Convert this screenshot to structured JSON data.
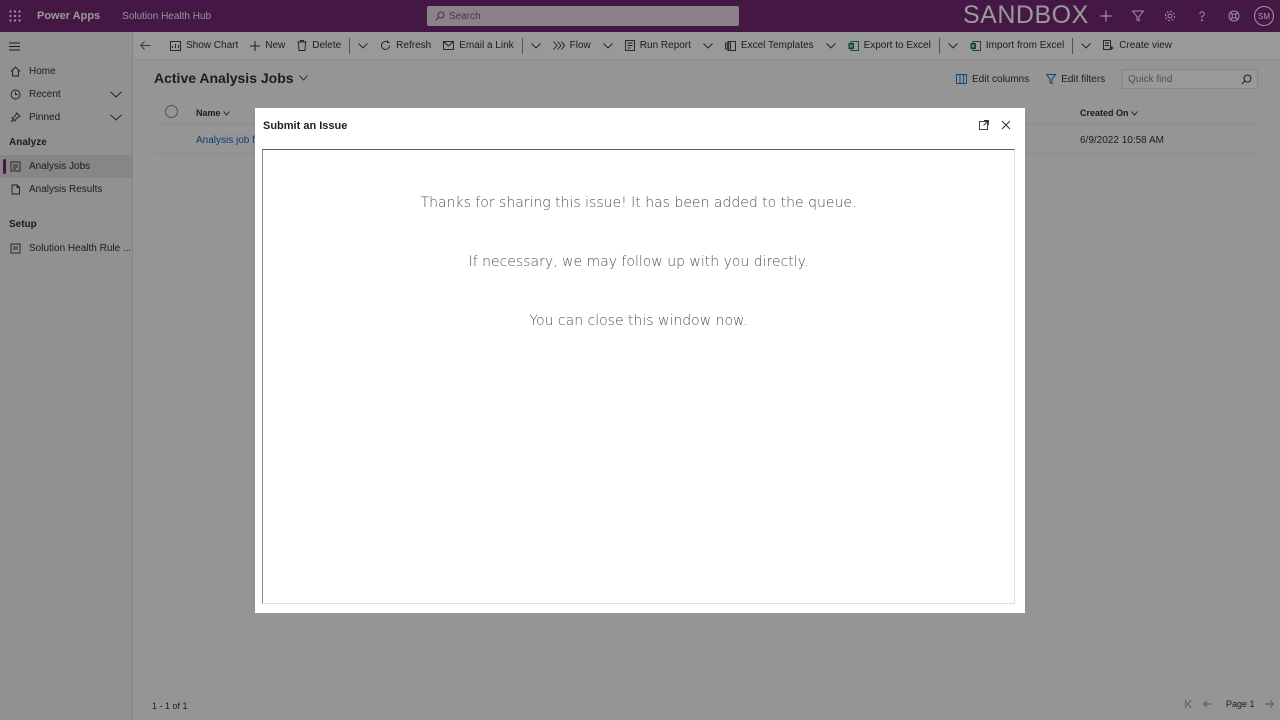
{
  "topbar": {
    "app_name": "Power Apps",
    "environment_title": "Solution Health Hub",
    "search_placeholder": "Search",
    "banner": "SANDBOX",
    "avatar_initials": "SM",
    "accent_color": "#742774"
  },
  "nav": {
    "items": [
      {
        "label": "Home"
      },
      {
        "label": "Recent"
      },
      {
        "label": "Pinned"
      }
    ],
    "groups": [
      {
        "label": "Analyze",
        "items": [
          {
            "label": "Analysis Jobs"
          },
          {
            "label": "Analysis Results"
          }
        ]
      },
      {
        "label": "Setup",
        "items": [
          {
            "label": "Solution Health Rule ..."
          }
        ]
      }
    ]
  },
  "commands": {
    "show_chart": "Show Chart",
    "new": "New",
    "delete": "Delete",
    "refresh": "Refresh",
    "email_link": "Email a Link",
    "flow": "Flow",
    "run_report": "Run Report",
    "excel_templates": "Excel Templates",
    "export_excel": "Export to Excel",
    "import_excel": "Import from Excel",
    "create_view": "Create view"
  },
  "view": {
    "title": "Active Analysis Jobs",
    "edit_columns": "Edit columns",
    "edit_filters": "Edit filters",
    "quick_find_placeholder": "Quick find"
  },
  "grid": {
    "columns": {
      "name": "Name",
      "created_on": "Created On"
    },
    "rows": [
      {
        "name": "Analysis job fo",
        "created_on": "6/9/2022 10:58 AM"
      }
    ],
    "count": "1 - 1 of 1",
    "page": "Page 1"
  },
  "dialog": {
    "title": "Submit an Issue",
    "messages": [
      "Thanks for sharing this issue! It has been added to the queue.",
      "If necessary, we may follow up with you directly.",
      "You can close this window now."
    ]
  }
}
